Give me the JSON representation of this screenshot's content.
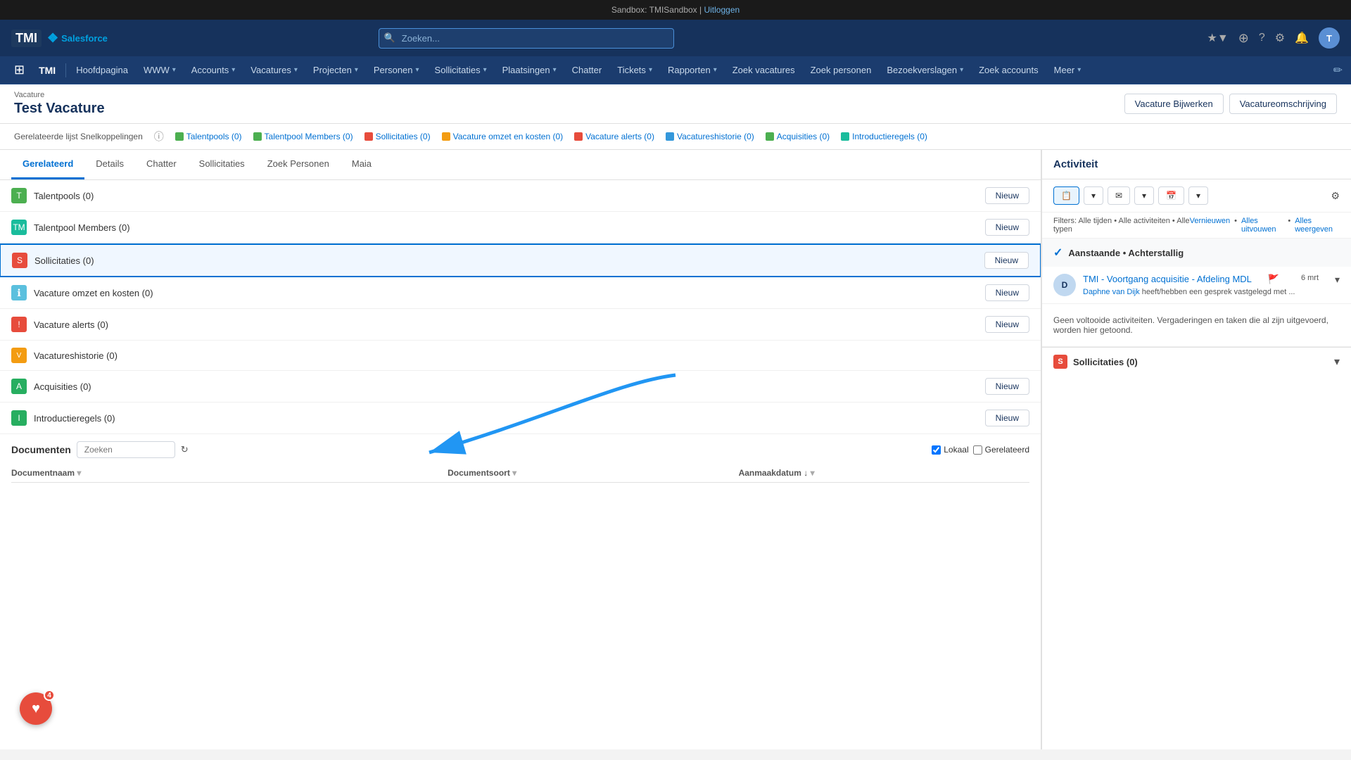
{
  "sandbox": {
    "label": "Sandbox: TMISandbox |",
    "logout_link": "Uitloggen"
  },
  "header": {
    "logo_tmi": "TMI",
    "logo_salesforce": "Salesforce",
    "search_placeholder": "Zoeken...",
    "actions": {
      "favorites_icon": "★",
      "add_icon": "+",
      "bell_icon": "🔔",
      "help_icon": "?",
      "gear_icon": "⚙",
      "notif_icon": "🔔",
      "avatar_initials": "T"
    }
  },
  "nav": {
    "apps_icon": "⊞",
    "tmi_label": "TMI",
    "items": [
      {
        "label": "Hoofdpagina",
        "has_dropdown": false
      },
      {
        "label": "WWW",
        "has_dropdown": true
      },
      {
        "label": "Accounts",
        "has_dropdown": true
      },
      {
        "label": "Vacatures",
        "has_dropdown": true
      },
      {
        "label": "Projecten",
        "has_dropdown": true
      },
      {
        "label": "Personen",
        "has_dropdown": true
      },
      {
        "label": "Sollicitaties",
        "has_dropdown": true
      },
      {
        "label": "Plaatsingen",
        "has_dropdown": true
      },
      {
        "label": "Chatter",
        "has_dropdown": false
      },
      {
        "label": "Tickets",
        "has_dropdown": true
      },
      {
        "label": "Rapporten",
        "has_dropdown": true
      },
      {
        "label": "Zoek vacatures",
        "has_dropdown": false
      },
      {
        "label": "Zoek personen",
        "has_dropdown": false
      },
      {
        "label": "Bezoekverslagen",
        "has_dropdown": true
      },
      {
        "label": "Zoek accounts",
        "has_dropdown": false
      },
      {
        "label": "Meer",
        "has_dropdown": true
      }
    ]
  },
  "page": {
    "breadcrumb": "Vacature",
    "title": "Test Vacature",
    "actions": {
      "edit_btn": "Vacature Bijwerken",
      "description_btn": "Vacatureomschrijving"
    }
  },
  "quick_links": {
    "label": "Gerelateerde lijst Snelkoppelingen",
    "items": [
      {
        "label": "Talentpools (0)",
        "color": "green"
      },
      {
        "label": "Talentpool Members (0)",
        "color": "green"
      },
      {
        "label": "Sollicitaties (0)",
        "color": "red"
      },
      {
        "label": "Vacature omzet en kosten (0)",
        "color": "yellow"
      },
      {
        "label": "Vacature alerts (0)",
        "color": "red"
      },
      {
        "label": "Vacatureshistorie (0)",
        "color": "blue"
      },
      {
        "label": "Acquisities (0)",
        "color": "green"
      },
      {
        "label": "Introductieregels (0)",
        "color": "teal"
      }
    ]
  },
  "tabs": [
    {
      "label": "Gerelateerd",
      "active": true
    },
    {
      "label": "Details",
      "active": false
    },
    {
      "label": "Chatter",
      "active": false
    },
    {
      "label": "Sollicitaties",
      "active": false
    },
    {
      "label": "Zoek Personen",
      "active": false
    },
    {
      "label": "Maia",
      "active": false
    }
  ],
  "sections": [
    {
      "name": "Talentpools (0)",
      "icon_color": "green",
      "icon_text": "T",
      "show_new": true
    },
    {
      "name": "Talentpool Members (0)",
      "icon_color": "teal",
      "icon_text": "TM",
      "show_new": true
    },
    {
      "name": "Sollicitaties (0)",
      "icon_color": "red",
      "icon_text": "S",
      "show_new": true,
      "highlighted": true
    },
    {
      "name": "Vacature omzet en kosten (0)",
      "icon_color": "orange",
      "icon_text": "i",
      "show_new": true
    },
    {
      "name": "Vacature alerts (0)",
      "icon_color": "red",
      "icon_text": "!",
      "show_new": true
    },
    {
      "name": "Vacatureshistorie (0)",
      "icon_color": "orange",
      "icon_text": "V",
      "show_new": false
    },
    {
      "name": "Acquisities (0)",
      "icon_color": "green",
      "icon_text": "A",
      "show_new": true
    },
    {
      "name": "Introductieregels (0)",
      "icon_color": "darkgreen",
      "icon_text": "I",
      "show_new": true
    }
  ],
  "documents": {
    "title": "Documenten",
    "search_placeholder": "Zoeken",
    "refresh_icon": "↻",
    "lokaal_label": "Lokaal",
    "gerelateerd_label": "Gerelateerd",
    "columns": [
      {
        "label": "Documentnaam",
        "sortable": true
      },
      {
        "label": "Documentsoort",
        "sortable": true
      },
      {
        "label": "Aanmaakdatum",
        "sortable": true,
        "sort_dir": "desc"
      }
    ]
  },
  "activity": {
    "panel_title": "Activiteit",
    "toolbar_btns": [
      {
        "label": "📋",
        "type": "log",
        "active": true
      },
      {
        "label": "✉",
        "type": "email"
      },
      {
        "label": "📅",
        "type": "task"
      },
      {
        "label": "▼",
        "type": "more"
      }
    ],
    "filters_label": "Filters: Alle tijden • Alle activiteiten • Alle typen",
    "filter_links": [
      {
        "label": "Vernieuwen"
      },
      {
        "label": "Alles uitvouwen"
      },
      {
        "label": "Alles weergeven"
      }
    ],
    "upcoming_section": "Aanstaande • Achterstallig",
    "items": [
      {
        "title": "TMI - Voortgang acquisitie - Afdeling MDL",
        "has_flag": true,
        "flag": "🚩",
        "meta": "heeft/hebben een gesprek vastgelegd met ...",
        "author": "Daphne van Dijk",
        "time": "6 mrt"
      }
    ],
    "no_activity_text": "Geen voltooide activiteiten. Vergaderingen en taken die al zijn uitgevoerd, worden hier getoond.",
    "sollicitaties_label": "Sollicitaties (0)"
  },
  "floating": {
    "heart_icon": "♥",
    "badge": "4",
    "plus_icon": "+"
  }
}
